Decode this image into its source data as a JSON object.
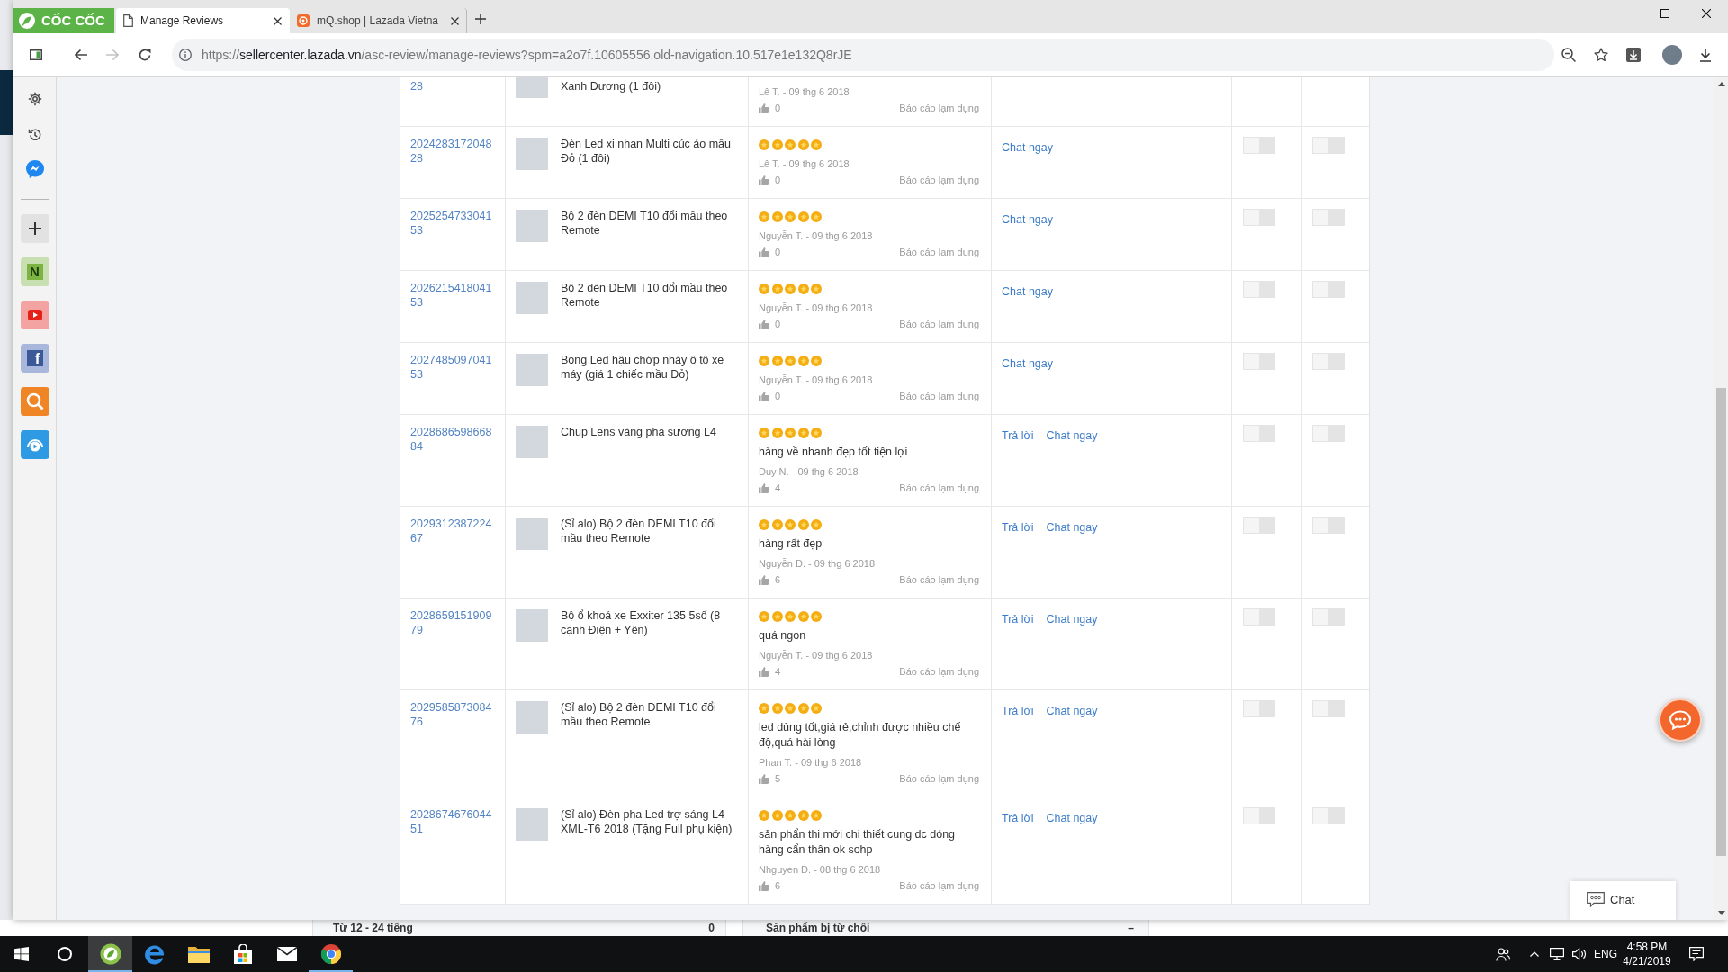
{
  "browser": {
    "logo_text": "CỐC CỐC",
    "tabs": [
      {
        "kind": "page",
        "title": "Manage Reviews",
        "selected": true
      },
      {
        "kind": "shop",
        "title": "mQ.shop | Lazada Vietna",
        "selected": false
      }
    ],
    "nav": [
      {
        "kind": "back",
        "disabled": false
      },
      {
        "kind": "forward",
        "disabled": true
      },
      {
        "kind": "reload",
        "disabled": false
      }
    ],
    "url": {
      "scheme": "https://",
      "host": "sellercenter.lazada.vn",
      "path": "/asc-review/manage-reviews?spm=a2o7f.10605556.old-navigation.10.517e1e132Q8rJE"
    }
  },
  "sidebar": {
    "note_glyph": "N",
    "facebook_glyph": "f"
  },
  "reviews": {
    "rows": [
      {
        "id": "28",
        "product": "Xanh Dương (1 đôi)",
        "reviewer": "Lê T. - 09 thg 6 2018",
        "likes": "0",
        "report": "Báo cáo lạm dụng"
      },
      {
        "id": "202428317204828",
        "product": "Đèn Led xi nhan Multi cúc áo mầu Đỏ (1 đôi)",
        "stars": 5,
        "reviewer": "Lê T. - 09 thg 6 2018",
        "likes": "0",
        "report": "Báo cáo lạm dụng",
        "actions": [
          "Chat ngay"
        ],
        "toggles": [
          {
            "on": false
          },
          {
            "on": false
          }
        ]
      },
      {
        "id": "202525473304153",
        "product": "Bộ 2 đèn DEMI T10 đổi mầu theo Remote",
        "stars": 5,
        "reviewer": "Nguyễn T. - 09 thg 6 2018",
        "likes": "0",
        "report": "Báo cáo lạm dụng",
        "actions": [
          "Chat ngay"
        ],
        "toggles": [
          {
            "on": false
          },
          {
            "on": false
          }
        ]
      },
      {
        "id": "202621541804153",
        "product": "Bộ 2 đèn DEMI T10 đổi mầu theo Remote",
        "stars": 5,
        "reviewer": "Nguyễn T. - 09 thg 6 2018",
        "likes": "0",
        "report": "Báo cáo lạm dụng",
        "actions": [
          "Chat ngay"
        ],
        "toggles": [
          {
            "on": false
          },
          {
            "on": false
          }
        ]
      },
      {
        "id": "202748509704153",
        "product": "Bóng Led hậu chớp nháy ô tô xe máy (giá 1 chiếc mầu Đỏ)",
        "stars": 5,
        "reviewer": "Nguyễn T. - 09 thg 6 2018",
        "likes": "0",
        "report": "Báo cáo lạm dụng",
        "actions": [
          "Chat ngay"
        ],
        "toggles": [
          {
            "on": false
          },
          {
            "on": false
          }
        ]
      },
      {
        "id": "202868659866884",
        "product": "Chup Lens vàng phá sương L4",
        "stars": 5,
        "review": "hàng về nhanh đẹp tốt tiện lợi",
        "reviewer": "Duy N. - 09 thg 6 2018",
        "likes": "4",
        "report": "Báo cáo lạm dụng",
        "actions": [
          "Trả lời",
          "Chat ngay"
        ],
        "toggles": [
          {
            "on": false
          },
          {
            "on": false
          }
        ]
      },
      {
        "id": "202931238722467",
        "product": "(Sỉ alo) Bộ 2 đèn DEMI T10 đổi mầu theo Remote",
        "stars": 5,
        "review": "hàng rất đẹp",
        "reviewer": "Nguyễn D. - 09 thg 6 2018",
        "likes": "6",
        "report": "Báo cáo lạm dụng",
        "actions": [
          "Trả lời",
          "Chat ngay"
        ],
        "toggles": [
          {
            "on": false
          },
          {
            "on": false
          }
        ]
      },
      {
        "id": "202865915190979",
        "product": "Bộ ổ khoá xe Exxiter 135 5số (8 cạnh Điện + Yên)",
        "stars": 5,
        "review": "quá ngon",
        "reviewer": "Nguyễn T. - 09 thg 6 2018",
        "likes": "4",
        "report": "Báo cáo lạm dụng",
        "actions": [
          "Trả lời",
          "Chat ngay"
        ],
        "toggles": [
          {
            "on": false
          },
          {
            "on": false
          }
        ]
      },
      {
        "id": "202958587308476",
        "product": "(Sỉ alo) Bộ 2 đèn DEMI T10 đổi mầu theo Remote",
        "stars": 5,
        "review": "led dùng tốt,giá rẻ,chỉnh được nhiều chế độ,quá hài lòng",
        "reviewer": "Phan T. - 09 thg 6 2018",
        "likes": "5",
        "report": "Báo cáo lạm dụng",
        "actions": [
          "Trả lời",
          "Chat ngay"
        ],
        "toggles": [
          {
            "on": false
          },
          {
            "on": false
          }
        ]
      },
      {
        "id": "202867467604451",
        "product": "(Sỉ alo) Đèn pha Led trợ sáng L4 XML-T6 2018 (Tặng Full phụ kiện)",
        "stars": 5,
        "review": "sản phẩn thi mới chi thiết cung dc dóng hàng cẩn thân ok sohp",
        "reviewer": "Nhguyen D. - 08 thg 6 2018",
        "likes": "6",
        "report": "Báo cáo lạm dụng",
        "actions": [
          "Trả lời",
          "Chat ngay"
        ],
        "toggles": [
          {
            "on": false
          },
          {
            "on": false
          }
        ]
      }
    ]
  },
  "chat_widget": {
    "label": "Chat"
  },
  "background_window": {
    "panels": [
      {
        "label": "Từ 12 - 24 tiếng",
        "count": "0"
      },
      {
        "label": "Sản phẩm bị từ chối",
        "count": "–"
      }
    ]
  },
  "taskbar": {
    "apps": [
      {
        "kind": "coccoc",
        "active": true,
        "running": true
      },
      {
        "kind": "edge",
        "active": false,
        "running": false
      },
      {
        "kind": "explorer",
        "active": false,
        "running": false
      },
      {
        "kind": "store",
        "active": false,
        "running": false
      },
      {
        "kind": "mail",
        "active": false,
        "running": false
      },
      {
        "kind": "chrome",
        "active": false,
        "running": true
      }
    ],
    "language": "ENG",
    "time": "4:58 PM",
    "date": "4/21/2019"
  }
}
